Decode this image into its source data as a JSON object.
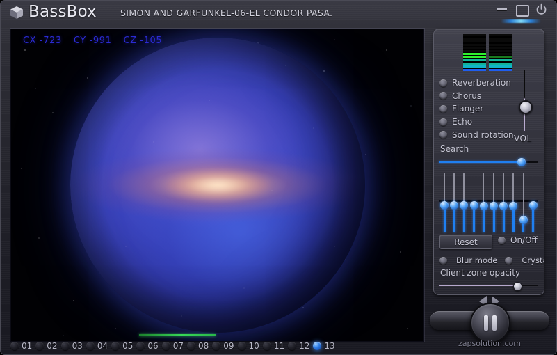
{
  "titlebar": {
    "app_name": "BassBox",
    "track_title": "SIMON AND GARFUNKEL-06-EL CONDOR PASA.",
    "icon": "cube-icon",
    "buttons": {
      "minimize": "minimize-icon",
      "maximize": "maximize-icon",
      "power": "power-icon"
    }
  },
  "viewport": {
    "coords": [
      {
        "axis": "CX",
        "value": "-723"
      },
      {
        "axis": "CY",
        "value": "-991"
      },
      {
        "axis": "CZ",
        "value": "-105"
      }
    ],
    "coord_color": "#2b2bd4",
    "scene": "galaxy-sphere",
    "progress_percent": 31,
    "progress_length_percent": 18.5,
    "progress_color": "#37d857"
  },
  "panel": {
    "vu_meter": {
      "segments_per_channel": 12,
      "left_levels": [
        "off",
        "off",
        "off",
        "off",
        "off",
        "off",
        "green",
        "green",
        "teal",
        "teal",
        "cyan",
        "blue"
      ],
      "right_levels": [
        "off",
        "off",
        "off",
        "off",
        "off",
        "off",
        "off",
        "dkgreen",
        "teal",
        "teal",
        "cyan",
        "blue"
      ],
      "colors": {
        "off": "#0a0a0a",
        "green": "#2ef02e",
        "dkgreen": "#1a7a1f",
        "teal": "#12b39a",
        "cyan": "#10b4c8",
        "blue": "#1f5ef0"
      }
    },
    "effects": [
      {
        "label": "Reverberation",
        "on": false
      },
      {
        "label": "Chorus",
        "on": false
      },
      {
        "label": "Flanger",
        "on": false
      },
      {
        "label": "Echo",
        "on": false
      },
      {
        "label": "Sound rotation",
        "on": false
      }
    ],
    "volume": {
      "label": "VOL",
      "position_percent": 50
    },
    "search": {
      "label": "Search",
      "position_percent": 84
    },
    "equalizer": {
      "band_count": 10,
      "band_positions": [
        40,
        40,
        40,
        40,
        41,
        41,
        41,
        41,
        61,
        40
      ]
    },
    "reset_label": "Reset",
    "onoff": {
      "label": "On/Off",
      "on": false
    },
    "modes": [
      {
        "label": "Blur mode",
        "on": false
      },
      {
        "label": "Crystal",
        "on": false
      }
    ],
    "client_zone_opacity": {
      "label": "Client zone opacity",
      "position_percent": 79
    }
  },
  "transport": {
    "prev_icon": "previous-triangle-icon",
    "next_icon": "next-triangle-icon",
    "play_state": "pause",
    "watermark": "zapsolution.com"
  },
  "tracks": {
    "items": [
      "01",
      "02",
      "03",
      "04",
      "05",
      "06",
      "07",
      "08",
      "09",
      "10",
      "11",
      "12",
      "13"
    ],
    "active": "13"
  }
}
